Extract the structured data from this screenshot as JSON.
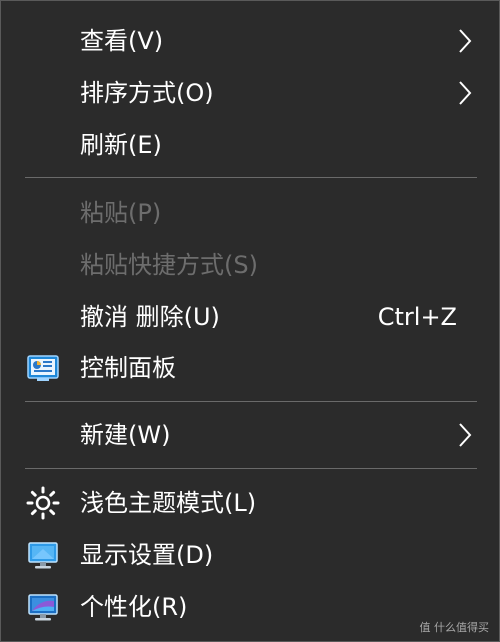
{
  "menu": {
    "view": {
      "label": "查看(V)"
    },
    "sort": {
      "label": "排序方式(O)"
    },
    "refresh": {
      "label": "刷新(E)"
    },
    "paste": {
      "label": "粘贴(P)"
    },
    "paste_shortcut": {
      "label": "粘贴快捷方式(S)"
    },
    "undo": {
      "label": "撤消 删除(U)",
      "shortcut": "Ctrl+Z"
    },
    "control_panel": {
      "label": "控制面板",
      "icon": "control-panel-icon"
    },
    "new": {
      "label": "新建(W)"
    },
    "light_theme": {
      "label": "浅色主题模式(L)",
      "icon": "sun-icon"
    },
    "display": {
      "label": "显示设置(D)",
      "icon": "display-monitor-icon"
    },
    "personalize": {
      "label": "个性化(R)",
      "icon": "personalize-monitor-icon"
    }
  },
  "watermark": {
    "text": "值 什么值得买"
  },
  "colors": {
    "background": "#2b2b2b",
    "text": "#ffffff",
    "disabled_text": "#6d6d6d",
    "separator": "#6a6a6a"
  }
}
